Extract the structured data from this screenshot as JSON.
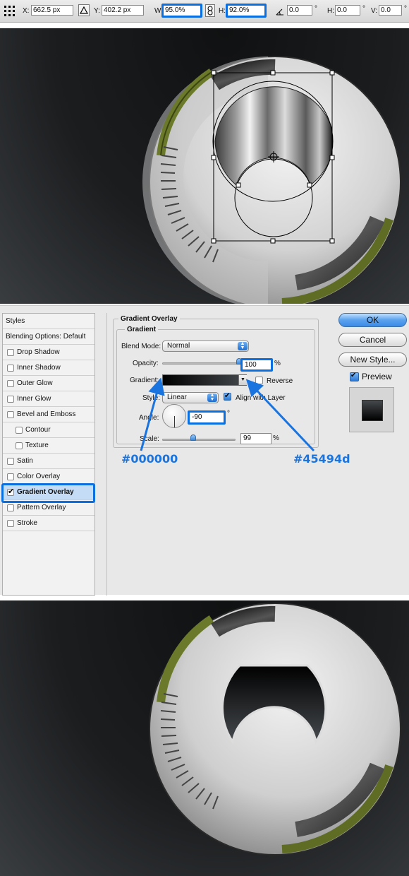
{
  "options_bar": {
    "x_label": "X:",
    "x_value": "662.5 px",
    "y_label": "Y:",
    "y_value": "402.2 px",
    "w_label": "W:",
    "w_value": "95.0%",
    "h_label": "H:",
    "h_value": "92.0%",
    "angle_value": "0.0",
    "angle_unit": "°",
    "hskew_label": "H:",
    "hskew_value": "0.0",
    "hskew_unit": "°",
    "vskew_label": "V:",
    "vskew_value": "0.0",
    "vskew_unit": "°"
  },
  "dialog": {
    "styles_list": {
      "header": "Styles",
      "blending": "Blending Options: Default",
      "items": [
        {
          "label": "Drop Shadow",
          "checked": false,
          "sub": false
        },
        {
          "label": "Inner Shadow",
          "checked": false,
          "sub": false
        },
        {
          "label": "Outer Glow",
          "checked": false,
          "sub": false
        },
        {
          "label": "Inner Glow",
          "checked": false,
          "sub": false
        },
        {
          "label": "Bevel and Emboss",
          "checked": false,
          "sub": false
        },
        {
          "label": "Contour",
          "checked": false,
          "sub": true
        },
        {
          "label": "Texture",
          "checked": false,
          "sub": true
        },
        {
          "label": "Satin",
          "checked": false,
          "sub": false
        },
        {
          "label": "Color Overlay",
          "checked": false,
          "sub": false
        },
        {
          "label": "Gradient Overlay",
          "checked": true,
          "sub": false,
          "selected": true
        },
        {
          "label": "Pattern Overlay",
          "checked": false,
          "sub": false
        },
        {
          "label": "Stroke",
          "checked": false,
          "sub": false
        }
      ]
    },
    "panel_title": "Gradient Overlay",
    "group_title": "Gradient",
    "blend_mode_label": "Blend Mode:",
    "blend_mode_value": "Normal",
    "opacity_label": "Opacity:",
    "opacity_value": "100",
    "opacity_unit": "%",
    "gradient_label": "Gradient:",
    "reverse_label": "Reverse",
    "reverse_checked": false,
    "style_label": "Style:",
    "style_value": "Linear",
    "align_label": "Align with Layer",
    "align_checked": true,
    "angle_label": "Angle:",
    "angle_value": "-90",
    "angle_unit": "°",
    "scale_label": "Scale:",
    "scale_value": "99",
    "scale_unit": "%",
    "opacity_level": 1.0,
    "scale_level": 0.99,
    "gradient_start_color": "#000000",
    "gradient_end_color": "#45494d",
    "buttons": {
      "ok": "OK",
      "cancel": "Cancel",
      "new_style": "New Style..."
    },
    "preview_label": "Preview",
    "preview_checked": true,
    "accent_color": "#0b6fe0"
  },
  "callouts": {
    "start_color": "#000000",
    "end_color": "#45494d"
  }
}
